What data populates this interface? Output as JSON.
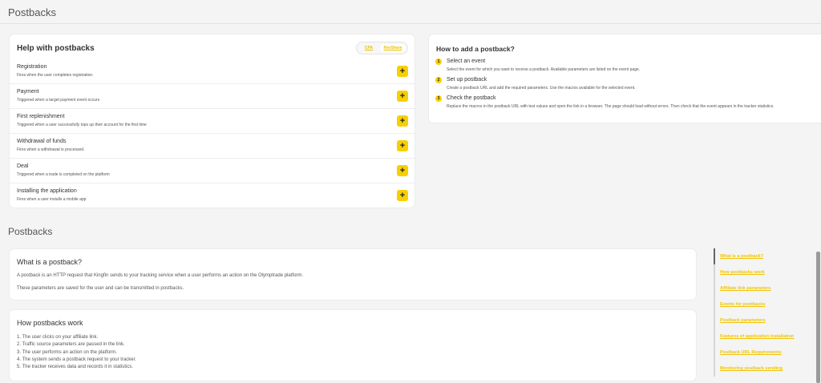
{
  "header": {
    "title": "Postbacks"
  },
  "help": {
    "title": "Help with postbacks",
    "toggle": {
      "option_a": "CPA",
      "option_b": "RevShare"
    },
    "events": [
      {
        "name": "Registration",
        "description": "Fires when the user completes registration."
      },
      {
        "name": "Payment",
        "description": "Triggered when a target payment event occurs"
      },
      {
        "name": "First replenishment",
        "description": "Triggered when a user successfully tops up their account for the first time"
      },
      {
        "name": "Withdrawal of funds",
        "description": "Fires when a withdrawal is processed."
      },
      {
        "name": "Deal",
        "description": "Triggered when a trade is completed on the platform"
      },
      {
        "name": "Installing the application",
        "description": "Fires when a user installs a mobile app"
      }
    ],
    "add_symbol": "+"
  },
  "how_to_add": {
    "title": "How to add a postback?",
    "steps": [
      {
        "number": "1",
        "title": "Select an event",
        "description": "Select the event for which you want to receive a postback. Available parameters are listed on the event page."
      },
      {
        "number": "2",
        "title": "Set up postback",
        "description": "Create a postback URL and add the required parameters. Use the macros available for the selected event."
      },
      {
        "number": "3",
        "title": "Check the postback",
        "description": "Replace the macros in the postback URL with test values and open the link in a browser. The page should load without errors. Then check that the event appears in the tracker statistics."
      }
    ]
  },
  "docs": {
    "section_title": "Postbacks",
    "what": {
      "title": "What is a postback?",
      "paragraph_1": "A postback is an HTTP request that Kingfin sends to your tracking service when a user performs an action on the Olymptrade platform.",
      "paragraph_2": "These parameters are saved for the user and can be transmitted in postbacks."
    },
    "how_works": {
      "title": "How postbacks work",
      "steps": [
        "1. The user clicks on your affiliate link.",
        "2. Traffic source parameters are passed in the link.",
        "3. The user performs an action on the platform.",
        "4. The system sends a postback request to your tracker.",
        "5. The tracker receives data and records it in statistics."
      ]
    }
  },
  "toc": {
    "items": [
      "What is a postback?",
      "How postbacks work",
      "Affiliate link parameters",
      "Events for postbacks",
      "Postback parameters",
      "Features of application installation",
      "Postback URL Requirements",
      "Monitoring postback sending"
    ],
    "active_index": 0
  },
  "colors": {
    "accent": "#f6d000",
    "link": "#f2c400",
    "background": "#f4f4f4",
    "card": "#ffffff"
  }
}
